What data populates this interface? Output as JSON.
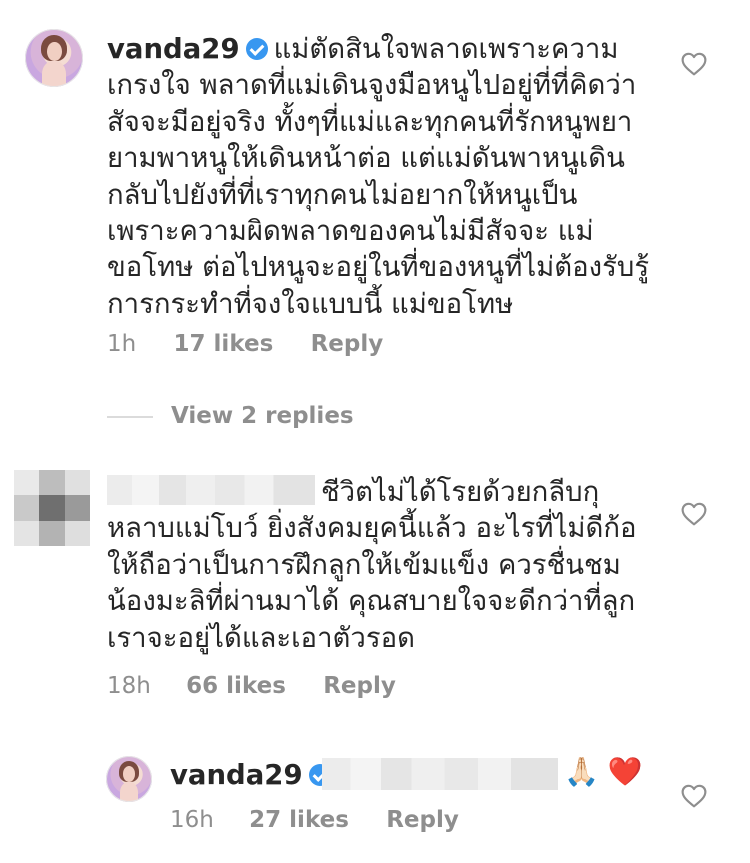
{
  "comments": [
    {
      "username": "vanda29",
      "verified": true,
      "text_lines": [
        "แม่ตัดสินใจพลาดเพราะความ",
        "เกรงใจ พลาดที่แม่เดินจูงมือหนูไปอยู่ที่ที่คิดว่า",
        "สัจจะมีอยู่จริง ทั้งๆที่แม่และทุกคนที่รักหนูพยา",
        "ยามพาหนูให้เดินหน้าต่อ แต่แม่ดันพาหนูเดิน",
        "กลับไปยังที่ที่เราทุกคนไม่อยากให้หนูเป็น",
        "เพราะความผิดพลาดของคนไม่มีสัจจะ แม่",
        "ขอโทษ ต่อไปหนูจะอยู่ในที่ของหนูที่ไม่ต้องรับรู้",
        "การกระทำที่จงใจแบบนี้ แม่ขอโทษ"
      ],
      "time": "1h",
      "likes": "17 likes",
      "reply": "Reply"
    },
    {
      "view_replies": "View 2 replies"
    },
    {
      "username": "",
      "text_lines": [
        "ชีวิตไม่ได้โรยด้วยกลีบกุ",
        "หลาบแม่โบว์ ยิ่งสังคมยุคนี้แล้ว อะไรที่ไม่ดีก้อ",
        "ให้ถือว่าเป็นการฝึกลูกให้เข้มแข็ง ควรชื่นชม",
        "น้องมะลิที่ผ่านมาได้ คุณสบายใจจะดีกว่าที่ลูก",
        "เราจะอยู่ได้และเอาตัวรอด"
      ],
      "time": "18h",
      "likes": "66 likes",
      "reply": "Reply"
    },
    {
      "username": "vanda29",
      "verified": true,
      "emoji": "🙏🏻 ❤️",
      "time": "16h",
      "likes": "27 likes",
      "reply": "Reply"
    }
  ],
  "icons": {
    "heart": "heart-outline-icon",
    "verified": "verified-badge-icon"
  },
  "colors": {
    "text": "#262626",
    "meta": "#8e8e8e",
    "verified": "#3897f0",
    "heart_emoji": "#e0245e"
  }
}
